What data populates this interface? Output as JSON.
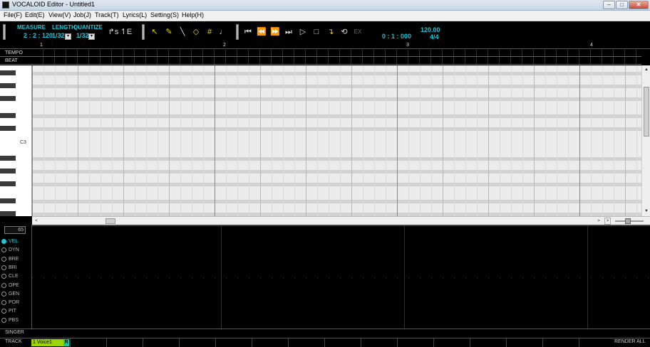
{
  "window": {
    "title": "VOCALOID Editor - Untitled1",
    "minimize_glyph": "‒",
    "maximize_glyph": "□",
    "close_glyph": "✕"
  },
  "menu": [
    {
      "label": "File(F)"
    },
    {
      "label": "Edit(E)"
    },
    {
      "label": "View(V)"
    },
    {
      "label": "Job(J)"
    },
    {
      "label": "Track(T)"
    },
    {
      "label": "Lyrics(L)"
    },
    {
      "label": "Setting(S)"
    },
    {
      "label": "Help(H)"
    }
  ],
  "toolbar": {
    "measure_label": "MEASURE",
    "measure_value": "2 : 2 : 120",
    "length_label": "LENGTH",
    "length_value": "1/32",
    "quantize_label": "QUANTIZE",
    "quantize_value": "1/32",
    "select_arrow": "▾",
    "time_value": "0 : 1 : 000",
    "tempo_value": "120.00",
    "beat_value": "4/4",
    "tools": {
      "arrow_s": "↱s",
      "arrow_e": "↿E",
      "pointer": "↖",
      "pencil": "✎",
      "line": "╲",
      "eraser": "◇",
      "grid": "#",
      "vibrato": "♩"
    },
    "transport": {
      "to_start": "⏮",
      "rewind": "⏪",
      "forward": "⏩",
      "to_end": "⏭",
      "play": "▷",
      "stop": "□",
      "rec": "↴",
      "loop": "⟲",
      "ex": "EX"
    }
  },
  "ruler": {
    "measures": [
      "1",
      "2",
      "3",
      "4"
    ]
  },
  "rows": {
    "tempo": "TEMPO",
    "beat": "BEAT"
  },
  "piano": {
    "c3_label": "C3"
  },
  "scrollbars": {
    "up": "▲",
    "down": "▼",
    "left": "<",
    "right": ">"
  },
  "control": {
    "value_box": "65",
    "params": [
      {
        "label": "VEL",
        "active": true
      },
      {
        "label": "DYN",
        "active": false
      },
      {
        "label": "BRE",
        "active": false
      },
      {
        "label": "BRI",
        "active": false
      },
      {
        "label": "CLE",
        "active": false
      },
      {
        "label": "OPE",
        "active": false
      },
      {
        "label": "GEN",
        "active": false
      },
      {
        "label": "POR",
        "active": false
      },
      {
        "label": "PIT",
        "active": false
      },
      {
        "label": "PBS",
        "active": false
      }
    ]
  },
  "bottom": {
    "singer_label": "SINGER",
    "track_label": "TRACK",
    "track1_name": "1 Voice1",
    "track1_r": "R",
    "render_all": "RENDER ALL"
  },
  "colors": {
    "accent_cyan": "#19c8d8",
    "tool_yellow": "#e8d000",
    "track_green": "#9cd600"
  }
}
